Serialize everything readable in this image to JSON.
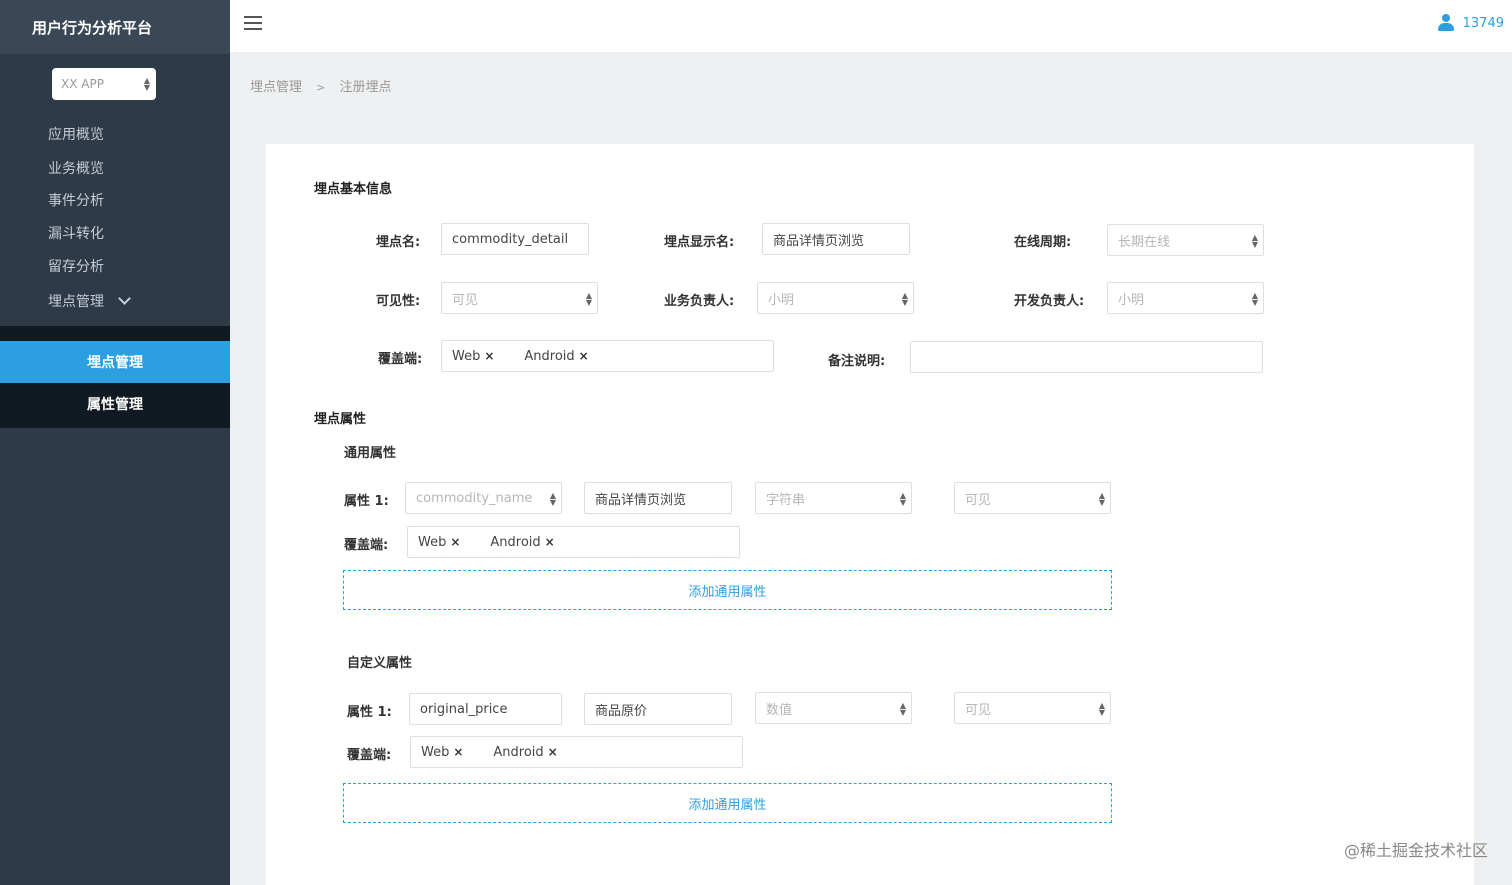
{
  "app": {
    "title": "用户行为分析平台"
  },
  "sidebar": {
    "app_select": "XX APP",
    "items": [
      {
        "label": "应用概览"
      },
      {
        "label": "业务概览"
      },
      {
        "label": "事件分析"
      },
      {
        "label": "漏斗转化"
      },
      {
        "label": "留存分析"
      },
      {
        "label": "埋点管理"
      }
    ],
    "sub_items": [
      {
        "label": "埋点管理",
        "active": true
      },
      {
        "label": "属性管理",
        "active": false
      }
    ]
  },
  "header": {
    "user": "13749"
  },
  "breadcrumb": {
    "parent": "埋点管理",
    "sep": ">",
    "current": "注册埋点"
  },
  "basic": {
    "title": "埋点基本信息",
    "name_label": "埋点名:",
    "name_value": "commodity_detail",
    "display_label": "埋点显示名:",
    "display_value": "商品详情页浏览",
    "period_label": "在线周期:",
    "period_value": "长期在线",
    "visibility_label": "可见性:",
    "visibility_value": "可见",
    "biz_owner_label": "业务负责人:",
    "biz_owner_value": "小明",
    "dev_owner_label": "开发负责人:",
    "dev_owner_value": "小明",
    "coverage_label": "覆盖端:",
    "coverage_tags": [
      "Web",
      "Android"
    ],
    "remark_label": "备注说明:",
    "remark_value": ""
  },
  "props": {
    "title": "埋点属性",
    "common": {
      "title": "通用属性",
      "attr_label": "属性 1:",
      "name": "commodity_name",
      "display": "商品详情页浏览",
      "type": "字符串",
      "visibility": "可见",
      "coverage_label": "覆盖端:",
      "coverage_tags": [
        "Web",
        "Android"
      ],
      "add_label": "添加通用属性"
    },
    "custom": {
      "title": "自定义属性",
      "attr_label": "属性 1:",
      "name": "original_price",
      "display": "商品原价",
      "type": "数值",
      "visibility": "可见",
      "coverage_label": "覆盖端:",
      "coverage_tags": [
        "Web",
        "Android"
      ],
      "add_label": "添加通用属性"
    }
  },
  "watermark": "@稀土掘金技术社区",
  "colors": {
    "sidebar": "#2e3a48",
    "accent": "#2d9fe0",
    "submenu": "#111a22"
  }
}
